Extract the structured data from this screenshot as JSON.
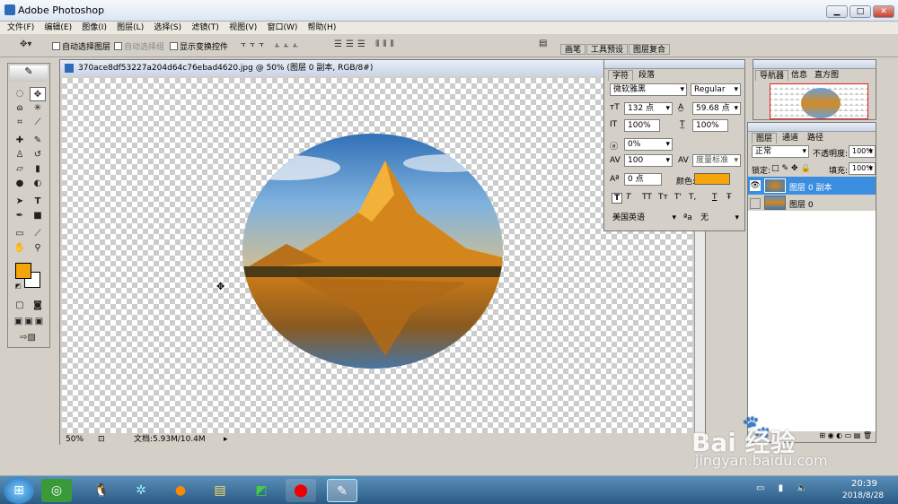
{
  "app": {
    "title": "Adobe Photoshop"
  },
  "menu": [
    "文件(F)",
    "编辑(E)",
    "图像(I)",
    "图层(L)",
    "选择(S)",
    "滤镜(T)",
    "视图(V)",
    "窗口(W)",
    "帮助(H)"
  ],
  "options": {
    "auto_select_layer": "自动选择图层",
    "auto_select_group": "自动选择组",
    "show_transform": "显示变换控件"
  },
  "well_tabs": [
    "画笔",
    "工具预设",
    "图层复合"
  ],
  "document": {
    "title": "370ace8df53227a204d64c76ebad4620.jpg @ 50% (图层 0 副本, RGB/8#)",
    "zoom": "50%",
    "doc_info": "文档:5.93M/10.4M"
  },
  "character": {
    "tabs": [
      "字符",
      "段落"
    ],
    "font_family": "微软雅黑",
    "font_style": "Regular",
    "font_size": "132 点",
    "leading": "59.68 点",
    "vscale": "100%",
    "hscale": "100%",
    "tracking_pct": "0%",
    "tracking": "100",
    "kerning": "度量标准",
    "baseline": "0 点",
    "color_label": "颜色:",
    "color": "#f5a50a",
    "styles": [
      "T",
      "T",
      "TT",
      "Tт",
      "T'",
      "T,",
      "T",
      "Ŧ"
    ],
    "language": "美国英语",
    "aa_label": "ªa",
    "aa": "无"
  },
  "navigator": {
    "tabs": [
      "导航器",
      "信息",
      "直方图"
    ]
  },
  "layers": {
    "tabs": [
      "图层",
      "通道",
      "路径"
    ],
    "blend": "正常",
    "opacity_label": "不透明度:",
    "opacity": "100%",
    "lock_label": "锁定:",
    "fill_label": "填充:",
    "fill": "100%",
    "items": [
      {
        "name": "图层 0 副本",
        "selected": true
      },
      {
        "name": "图层 0",
        "selected": false
      }
    ]
  },
  "taskbar": {
    "time": "20:39",
    "date": "2018/8/28"
  },
  "watermark": {
    "site": "jingyan.baidu.com"
  },
  "colors": {
    "foreground": "#f5a50a",
    "background": "#ffffff",
    "selection": "#3b8de0"
  }
}
